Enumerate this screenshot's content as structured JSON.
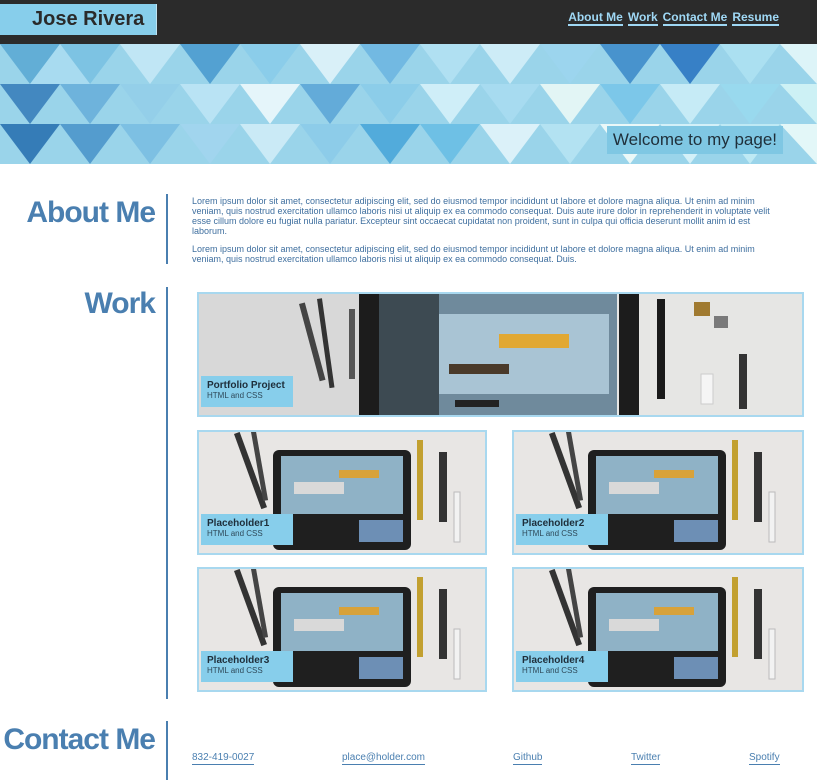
{
  "header": {
    "brand": "Jose Rivera",
    "nav": [
      "About Me",
      "Work",
      "Contact Me",
      "Resume"
    ]
  },
  "hero": {
    "welcome": "Welcome to my page!"
  },
  "about": {
    "title": "About Me",
    "paragraphs": [
      "Lorem ipsum dolor sit amet, consectetur adipiscing elit, sed do eiusmod tempor incididunt ut labore et dolore magna aliqua. Ut enim ad minim veniam, quis nostrud exercitation ullamco laboris nisi ut aliquip ex ea commodo consequat. Duis aute irure dolor in reprehenderit in voluptate velit esse cillum dolore eu fugiat nulla pariatur. Excepteur sint occaecat cupidatat non proident, sunt in culpa qui officia deserunt mollit anim id est laborum.",
      "Lorem ipsum dolor sit amet, consectetur adipiscing elit, sed do eiusmod tempor incididunt ut labore et dolore magna aliqua. Ut enim ad minim veniam, quis nostrud exercitation ullamco laboris nisi ut aliquip ex ea commodo consequat. Duis."
    ]
  },
  "work": {
    "title": "Work",
    "projects": [
      {
        "name": "Portfolio Project",
        "tech": "HTML and CSS"
      },
      {
        "name": "Placeholder1",
        "tech": "HTML and CSS"
      },
      {
        "name": "Placeholder2",
        "tech": "HTML and CSS"
      },
      {
        "name": "Placeholder3",
        "tech": "HTML and CSS"
      },
      {
        "name": "Placeholder4",
        "tech": "HTML and CSS"
      }
    ]
  },
  "contact": {
    "title": "Contact Me",
    "links": [
      "832-419-0027",
      "place@holder.com",
      "Github",
      "Twitter",
      "Spotify"
    ]
  },
  "colors": {
    "accent": "#87ceeb",
    "heading": "#4a7fb0",
    "header_bg": "#2b2b2b"
  }
}
